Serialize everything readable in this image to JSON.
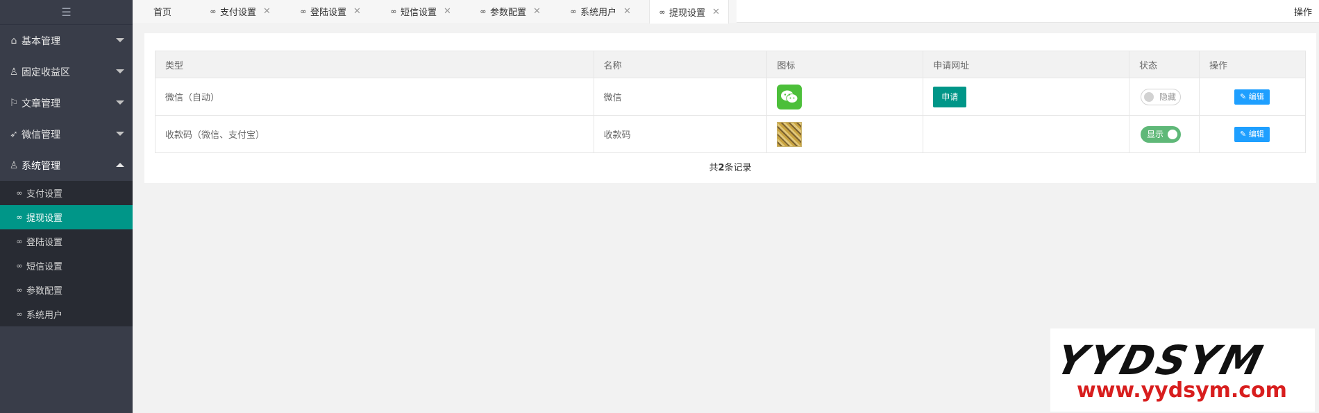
{
  "sidebar": {
    "toggle_icon": "menu-fold-icon",
    "groups": [
      {
        "label": "基本管理",
        "icon": "home-icon"
      },
      {
        "label": "固定收益区",
        "icon": "user-icon"
      },
      {
        "label": "文章管理",
        "icon": "flag-icon"
      },
      {
        "label": "微信管理",
        "icon": "send-icon"
      },
      {
        "label": "系统管理",
        "icon": "user-icon"
      }
    ],
    "sub_items": [
      {
        "label": "支付设置"
      },
      {
        "label": "提现设置"
      },
      {
        "label": "登陆设置"
      },
      {
        "label": "短信设置"
      },
      {
        "label": "参数配置"
      },
      {
        "label": "系统用户"
      }
    ]
  },
  "tabs": [
    {
      "label": "首页"
    },
    {
      "label": "支付设置"
    },
    {
      "label": "登陆设置"
    },
    {
      "label": "短信设置"
    },
    {
      "label": "参数配置"
    },
    {
      "label": "系统用户"
    },
    {
      "label": "提现设置"
    }
  ],
  "top_action": "操作",
  "table": {
    "headers": [
      "类型",
      "名称",
      "图标",
      "申请网址",
      "状态",
      "操作"
    ],
    "rows": [
      {
        "type": "微信（自动）",
        "name": "微信",
        "apply": "申请",
        "status": "隐藏",
        "edit": "编辑"
      },
      {
        "type": "收款码（微信、支付宝）",
        "name": "收款码",
        "apply": "",
        "status": "显示",
        "edit": "编辑"
      }
    ]
  },
  "pagination": {
    "prefix": "共",
    "count": "2",
    "suffix": "条记录"
  },
  "watermark": {
    "brand": "YYDSYM",
    "url": "www.yydsym.com"
  },
  "colors": {
    "sidebar_bg": "#393d49",
    "active_teal": "#009688",
    "edit_blue": "#1e9fff",
    "switch_on": "#5fb878"
  }
}
